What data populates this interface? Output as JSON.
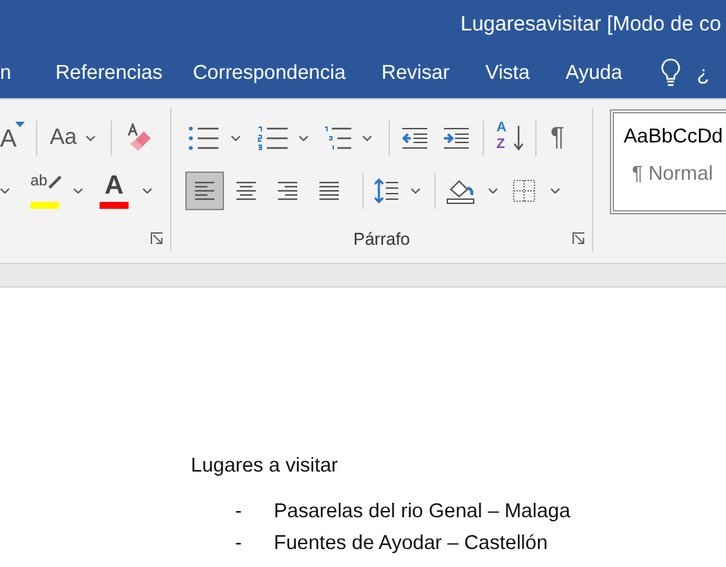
{
  "window": {
    "title": "Lugaresavisitar [Modo de co"
  },
  "tabs": [
    {
      "label": "n",
      "selected": false
    },
    {
      "label": "Referencias",
      "selected": false
    },
    {
      "label": "Correspondencia",
      "selected": false
    },
    {
      "label": "Revisar",
      "selected": false
    },
    {
      "label": "Vista",
      "selected": false
    },
    {
      "label": "Ayuda",
      "selected": false
    }
  ],
  "tell_me": {
    "text": "¿"
  },
  "ribbon": {
    "font_group": {
      "grow_font_glyph": "A",
      "change_case": "Aa",
      "highlight_glyph": "ab",
      "font_color_glyph": "A"
    },
    "paragraph_group": {
      "label": "Párrafo",
      "sort_glyphs": [
        "A",
        "Z"
      ],
      "show_marks_glyph": "¶",
      "alignment": [
        {
          "kind": "left",
          "selected": true
        },
        {
          "kind": "center",
          "selected": false
        },
        {
          "kind": "right",
          "selected": false
        },
        {
          "kind": "justify",
          "selected": false
        }
      ]
    },
    "styles": [
      {
        "sample": "AaBbCcDd",
        "name": "¶ Normal",
        "selected": true
      }
    ]
  },
  "document": {
    "heading": "Lugares a visitar",
    "list": [
      {
        "bullet": "-",
        "text": "Pasarelas del rio Genal – Malaga"
      },
      {
        "bullet": "-",
        "text": "Fuentes de Ayodar – Castellón"
      }
    ]
  }
}
